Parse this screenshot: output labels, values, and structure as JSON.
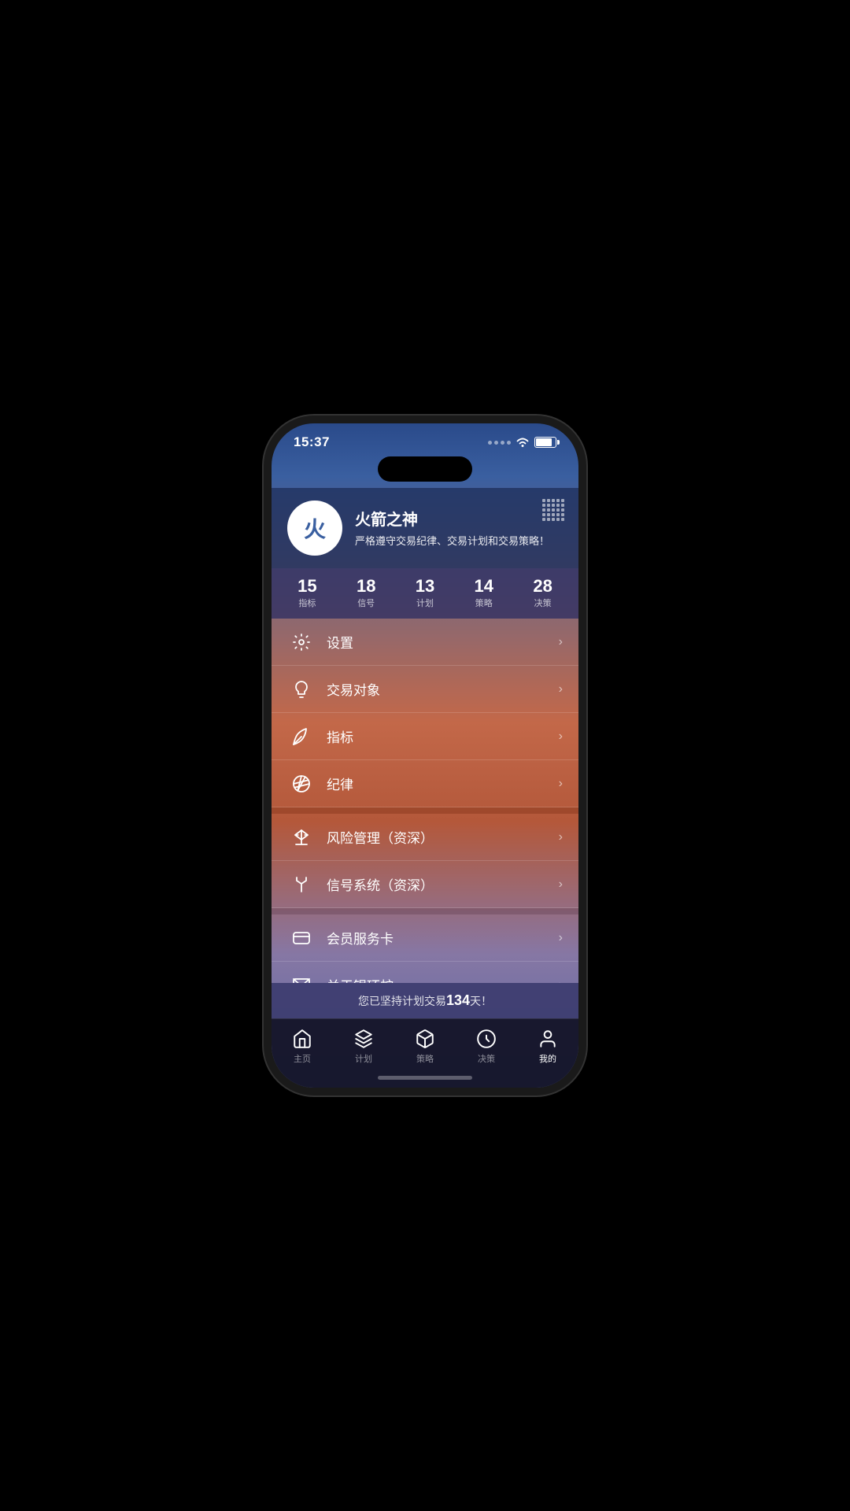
{
  "status": {
    "time": "15:37"
  },
  "header": {
    "avatar_char": "火",
    "user_name": "火箭之神",
    "user_motto": "严格遵守交易纪律、交易计划和交易策略！",
    "grid_icon_label": "grid-icon"
  },
  "stats": [
    {
      "id": "stat-indicators",
      "number": "15",
      "label": "指标"
    },
    {
      "id": "stat-signals",
      "number": "18",
      "label": "信号"
    },
    {
      "id": "stat-plans",
      "number": "13",
      "label": "计划"
    },
    {
      "id": "stat-strategies",
      "number": "14",
      "label": "策略"
    },
    {
      "id": "stat-decisions",
      "number": "28",
      "label": "决策"
    }
  ],
  "menu_items": [
    {
      "id": "settings",
      "label": "设置",
      "icon": "gear"
    },
    {
      "id": "trading-objects",
      "label": "交易对象",
      "icon": "bulb"
    },
    {
      "id": "indicators",
      "label": "指标",
      "icon": "leaf"
    },
    {
      "id": "discipline",
      "label": "纪律",
      "icon": "aperture"
    },
    {
      "id": "risk-management",
      "label": "风险管理（资深）",
      "icon": "scale"
    },
    {
      "id": "signal-system",
      "label": "信号系统（资深）",
      "icon": "fork"
    },
    {
      "id": "membership",
      "label": "会员服务卡",
      "icon": "card"
    },
    {
      "id": "about",
      "label": "关于银环蛇",
      "icon": "envelope"
    }
  ],
  "banner": {
    "prefix": "您已坚持计划交易",
    "days": "134",
    "suffix": "天！"
  },
  "tabs": [
    {
      "id": "home",
      "label": "主页",
      "icon": "home",
      "active": false
    },
    {
      "id": "plan",
      "label": "计划",
      "icon": "plan",
      "active": false
    },
    {
      "id": "strategy",
      "label": "策略",
      "icon": "strategy",
      "active": false
    },
    {
      "id": "decision",
      "label": "决策",
      "icon": "decision",
      "active": false
    },
    {
      "id": "mine",
      "label": "我的",
      "icon": "person",
      "active": true
    }
  ]
}
